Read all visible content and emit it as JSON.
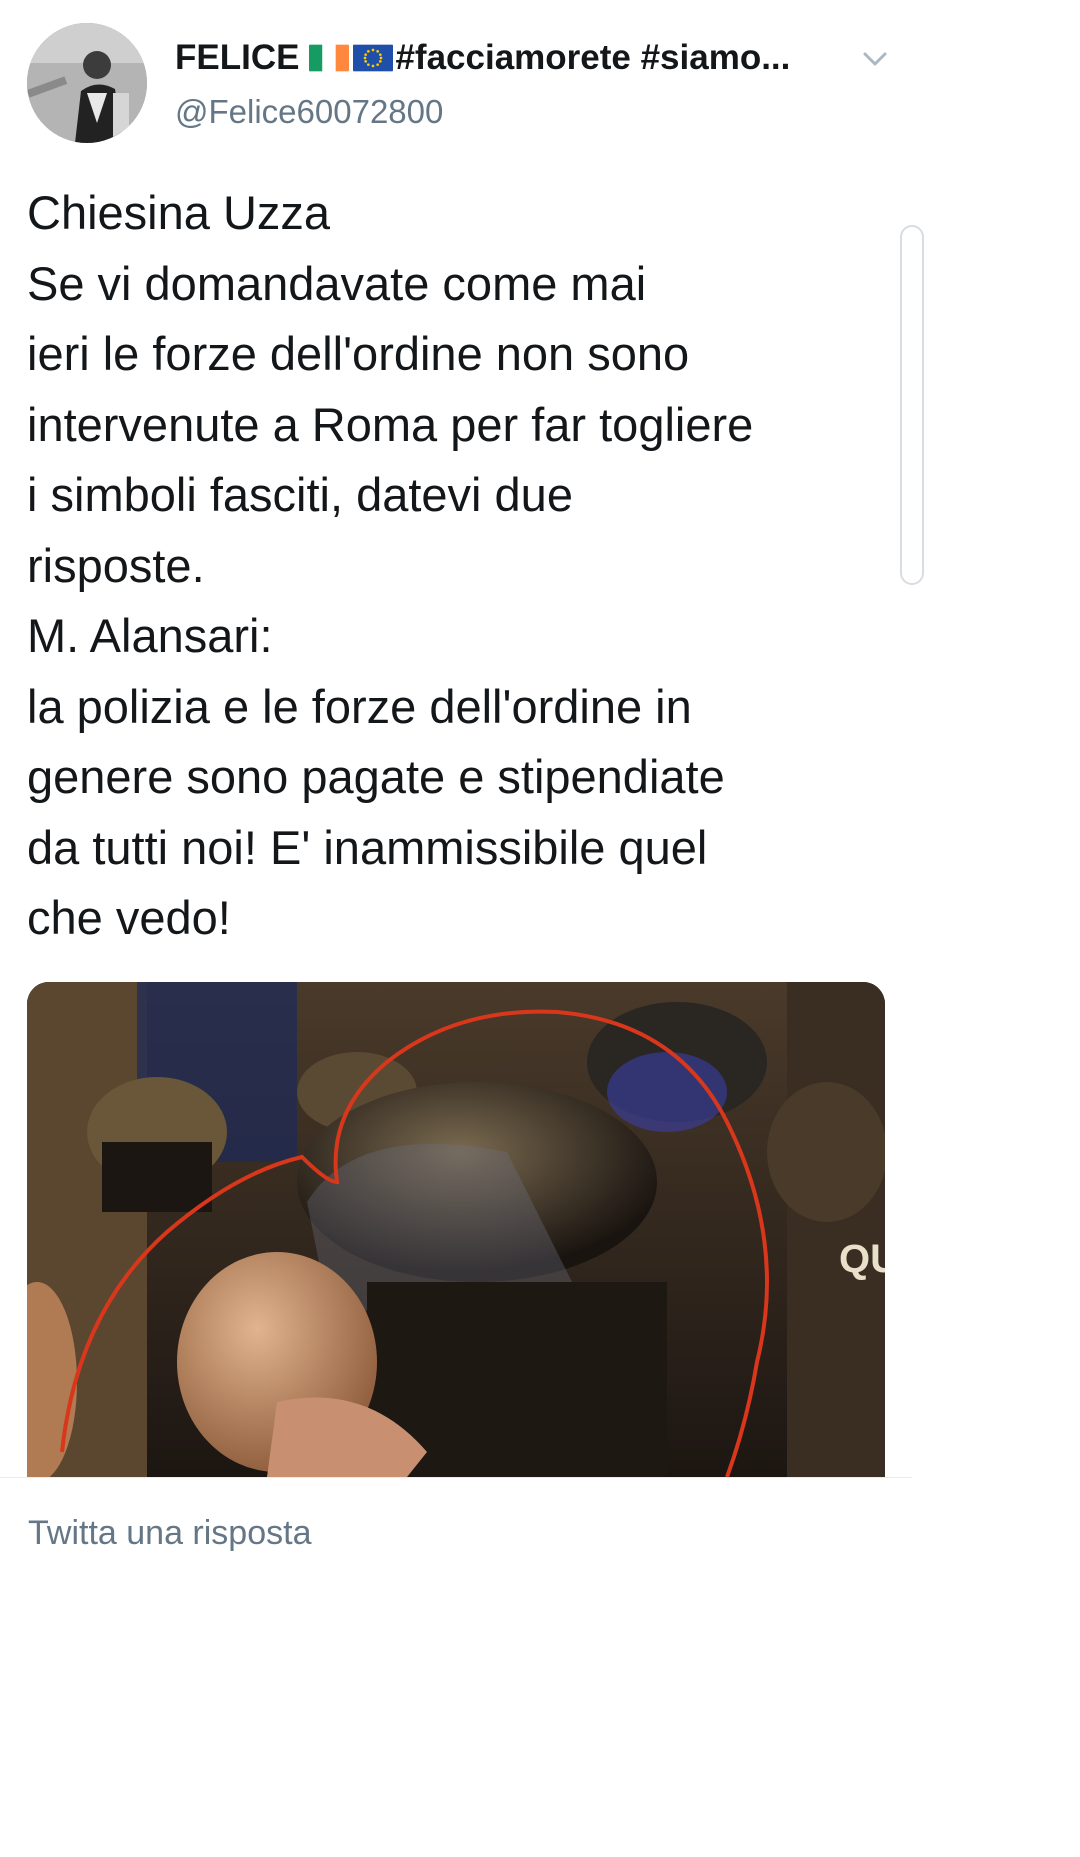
{
  "tweet": {
    "author": {
      "display_name": "FELICE",
      "flags": [
        "flag-ireland-icon",
        "flag-eu-icon"
      ],
      "name_suffix": "#facciamorete #siamo...",
      "handle": "@Felice60072800"
    },
    "text_lines": [
      "Chiesina Uzza",
      "Se vi domandavate come mai",
      "ieri le forze dell'ordine non sono",
      "intervenute a Roma per far togliere",
      "i simboli fasciti, datevi due",
      "risposte.",
      "M. Alansari:",
      "la polizia e le forze dell'ordine in",
      "genere sono pagate e stipendiate",
      "da tutti noi! E' inammissibile quel",
      "che vedo!"
    ],
    "media_overlay_text": "QU"
  },
  "reply": {
    "placeholder": "Twitta una risposta"
  },
  "colors": {
    "text": "#14171a",
    "secondary": "#657786",
    "divider": "#e6ecf0",
    "annotation_red": "#d8371c"
  }
}
